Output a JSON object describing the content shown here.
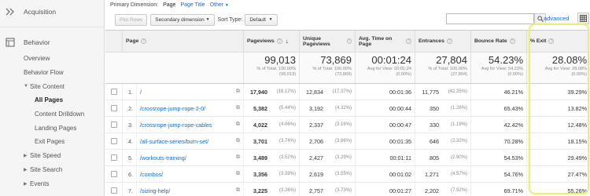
{
  "sidebar": {
    "acquisition": "Acquisition",
    "behavior": "Behavior",
    "items": [
      {
        "label": "Overview"
      },
      {
        "label": "Behavior Flow"
      },
      {
        "label": "Site Content"
      },
      {
        "label": "All Pages"
      },
      {
        "label": "Content Drilldown"
      },
      {
        "label": "Landing Pages"
      },
      {
        "label": "Exit Pages"
      },
      {
        "label": "Site Speed"
      },
      {
        "label": "Site Search"
      },
      {
        "label": "Events"
      }
    ]
  },
  "dimension": {
    "label": "Primary Dimension:",
    "selected": "Page",
    "alt": "Page Title",
    "other": "Other"
  },
  "toolbar": {
    "plot_rows": "Plot Rows",
    "secondary": "Secondary dimension",
    "sort_type_label": "Sort Type:",
    "sort_type_value": "Default",
    "advanced": "advanced"
  },
  "table": {
    "headers": {
      "page": "Page",
      "pageviews": "Pageviews",
      "unique": "Unique Pageviews",
      "avg_time": "Avg. Time on Page",
      "entrances": "Entrances",
      "bounce": "Bounce Rate",
      "exit": "% Exit"
    },
    "totals": {
      "pageviews": "99,013",
      "pageviews_sub": "% of Total: 100.00% (99,013)",
      "unique": "73,869",
      "unique_sub": "% of Total: 100.00% (73,869)",
      "avg_time": "00:01:24",
      "avg_time_sub": "Avg for View: 00:01:24 (0.00%)",
      "entrances": "27,804",
      "entrances_sub": "% of Total: 100.00% (27,804)",
      "bounce": "54.23%",
      "bounce_sub": "Avg for View: 54.23% (0.00%)",
      "exit": "28.08%",
      "exit_sub": "Avg for View: 28.08% (0.00%)"
    },
    "rows": [
      {
        "n": "1.",
        "page": "/",
        "pv": "17,940",
        "pv_pct": "(18.12%)",
        "upv": "12,834",
        "upv_pct": "(17.37%)",
        "avg": "00:01:36",
        "ent": "11,775",
        "ent_pct": "(42.35%)",
        "br": "46.21%",
        "exit": "39.29%"
      },
      {
        "n": "2.",
        "page": "/crossrope-jump-rope-2-0/",
        "pv": "5,382",
        "pv_pct": "(5.44%)",
        "upv": "3,192",
        "upv_pct": "(4.32%)",
        "avg": "00:00:44",
        "ent": "350",
        "ent_pct": "(1.26%)",
        "br": "65.43%",
        "exit": "13.82%"
      },
      {
        "n": "3.",
        "page": "/crossrope-jump-rope-cables",
        "pv": "4,022",
        "pv_pct": "(4.06%)",
        "upv": "2,337",
        "upv_pct": "(3.16%)",
        "avg": "00:00:47",
        "ent": "330",
        "ent_pct": "(1.19%)",
        "br": "42.42%",
        "exit": "12.48%"
      },
      {
        "n": "4.",
        "page": "/all-surface-series/burn-set/",
        "pv": "3,701",
        "pv_pct": "(3.74%)",
        "upv": "2,706",
        "upv_pct": "(3.66%)",
        "avg": "00:01:35",
        "ent": "646",
        "ent_pct": "(2.32%)",
        "br": "70.28%",
        "exit": "18.15%"
      },
      {
        "n": "5.",
        "page": "/workouts-training/",
        "pv": "3,489",
        "pv_pct": "(3.52%)",
        "upv": "2,427",
        "upv_pct": "(3.29%)",
        "avg": "00:01:11",
        "ent": "805",
        "ent_pct": "(2.90%)",
        "br": "54.53%",
        "exit": "29.49%"
      },
      {
        "n": "6.",
        "page": "/combos/",
        "pv": "3,356",
        "pv_pct": "(3.39%)",
        "upv": "2,619",
        "upv_pct": "(3.55%)",
        "avg": "00:01:02",
        "ent": "1,271",
        "ent_pct": "(4.57%)",
        "br": "54.76%",
        "exit": "27.47%"
      },
      {
        "n": "7.",
        "page": "/sizing-help/",
        "pv": "3,225",
        "pv_pct": "(3.26%)",
        "upv": "2,757",
        "upv_pct": "(3.73%)",
        "avg": "00:01:27",
        "ent": "2,202",
        "ent_pct": "(7.92%)",
        "br": "69.71%",
        "exit": "55.26%"
      }
    ]
  }
}
